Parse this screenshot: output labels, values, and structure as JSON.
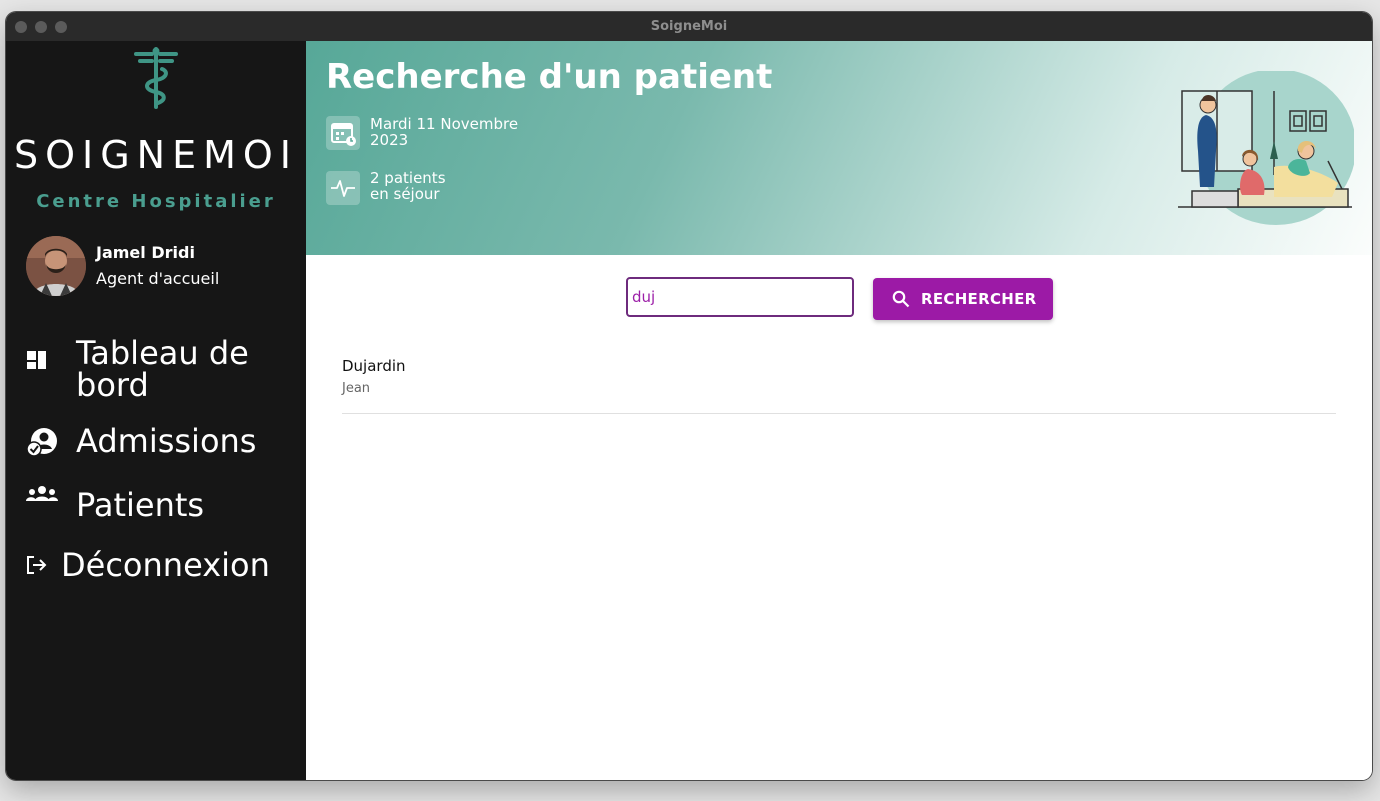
{
  "window": {
    "title": "SoigneMoi"
  },
  "sidebar": {
    "brand": "SOIGNEMOI",
    "subtitle": "Centre Hospitalier",
    "user": {
      "name": "Jamel Dridi",
      "role": "Agent d'accueil"
    },
    "nav": [
      {
        "label": "Tableau de bord",
        "icon": "dashboard-icon"
      },
      {
        "label": "Admissions",
        "icon": "admission-icon"
      },
      {
        "label": "Patients",
        "icon": "group-icon"
      },
      {
        "label": "Déconnexion",
        "icon": "logout-icon"
      }
    ]
  },
  "header": {
    "title": "Recherche d'un patient",
    "date_line1": "Mardi 11 Novembre",
    "date_line2": "2023",
    "stay_line1": "2 patients",
    "stay_line2": "en séjour"
  },
  "search": {
    "value": "duj",
    "button_label": "RECHERCHER"
  },
  "results": [
    {
      "last_name": "Dujardin",
      "first_name": "Jean"
    }
  ],
  "colors": {
    "accent": "#9c1aa6",
    "teal": "#4a9e8f",
    "sidebar_bg": "#161616"
  }
}
